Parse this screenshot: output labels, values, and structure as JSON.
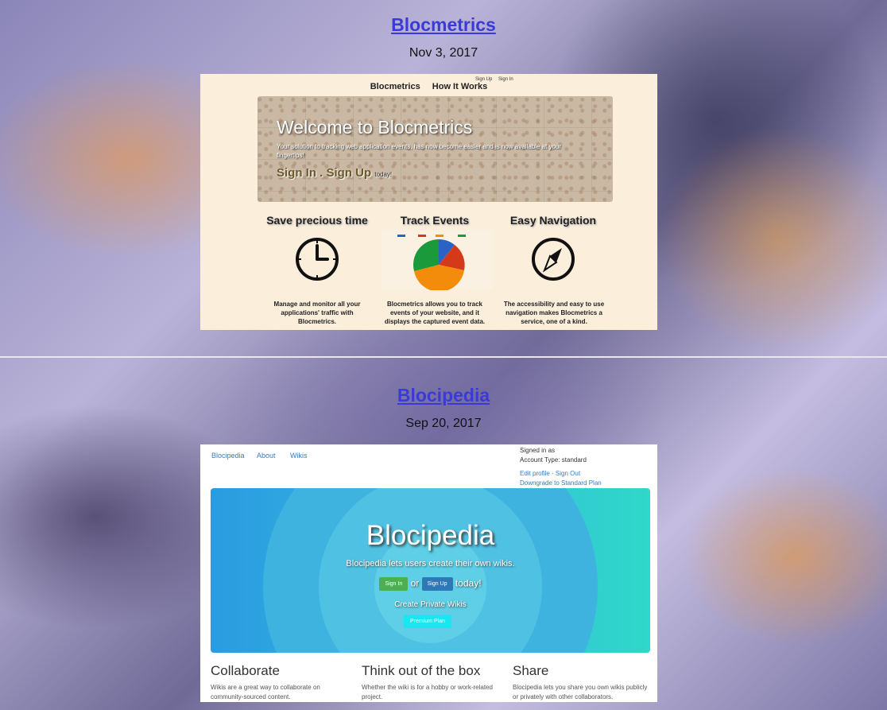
{
  "posts": [
    {
      "title": "Blocmetrics",
      "date": "Nov 3, 2017",
      "screenshot": {
        "nav": [
          "Blocmetrics",
          "How It Works"
        ],
        "nav_small": [
          "Sign Up",
          "Sign In"
        ],
        "hero_title": "Welcome to Blocmetrics",
        "hero_sub": "Your solution to tracking web application events, has now become easier and is now available at your fingertips!",
        "hero_cta": "Sign In . Sign Up",
        "hero_cta_small": "today!",
        "features": [
          {
            "title": "Save precious time",
            "icon": "clock-icon",
            "text": "Manage and monitor all your applications' traffic with Blocmetrics."
          },
          {
            "title": "Track Events",
            "icon": "pie-chart-icon",
            "text": "Blocmetrics allows you to track events of your website, and it displays the captured event data."
          },
          {
            "title": "Easy Navigation",
            "icon": "compass-icon",
            "text": "The accessibility and easy to use navigation makes Blocmetrics a service, one of a kind."
          }
        ],
        "pie_colors": [
          "#2a63c4",
          "#d43a1a",
          "#f28c0a",
          "#1a9a3a"
        ]
      }
    },
    {
      "title": "Blocipedia",
      "date": "Sep 20, 2017",
      "screenshot": {
        "nav": [
          "Blocipedia",
          "About",
          "Wikis"
        ],
        "account": {
          "signed_in": "Signed in as",
          "type": "Account Type: standard",
          "edit": "Edit profile - Sign Out",
          "downgrade": "Downgrade to Standard Plan"
        },
        "jumbo_title": "Blocipedia",
        "jumbo_sub": "Blocipedia lets users create their own wikis.",
        "sign_in": "Sign In",
        "or": "or",
        "sign_up": "Sign Up",
        "today": "today!",
        "private": "Create Private Wikis",
        "premium": "Premium Plan",
        "columns": [
          {
            "heading": "Collaborate",
            "text": "Wikis are a great way to collaborate on community-sourced content."
          },
          {
            "heading": "Think out of the box",
            "text": "Whether the wiki is for a hobby or work-related project."
          },
          {
            "heading": "Share",
            "text": "Blocipedia lets you share you own wikis publicly or privately with other collaborators."
          }
        ]
      }
    }
  ]
}
